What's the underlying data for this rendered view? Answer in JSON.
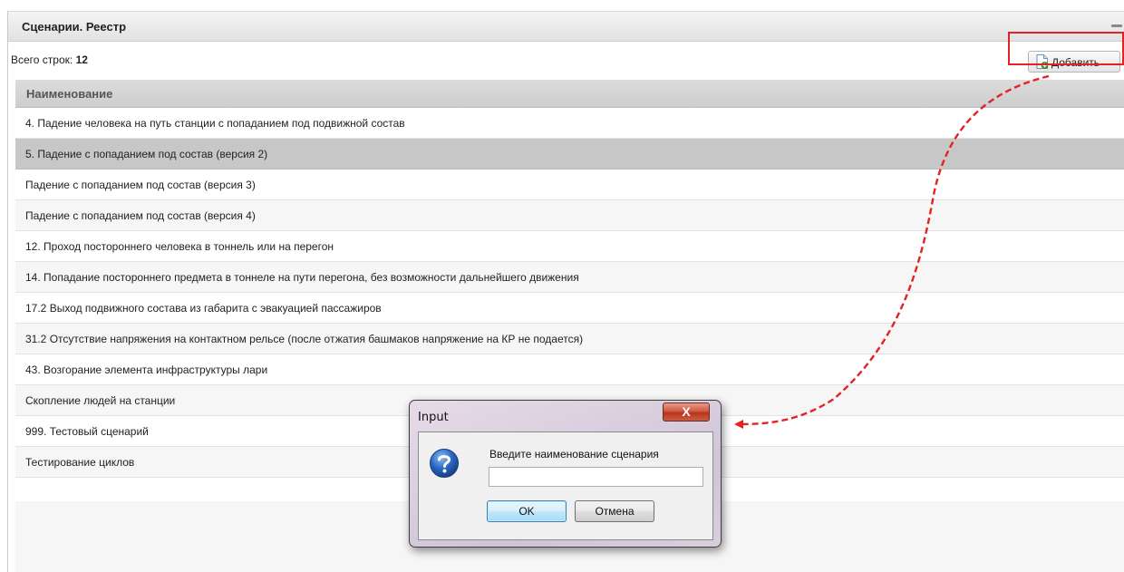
{
  "panel": {
    "title": "Сценарии. Реестр"
  },
  "toolbar": {
    "rows_label": "Всего строк:",
    "rows_count": "12",
    "add_label": "Добавить"
  },
  "grid": {
    "column_header": "Наименование",
    "selected_row_index": 1,
    "rows": [
      "4. Падение человека на путь станции с попаданием под подвижной состав",
      "5. Падение с попаданием под состав (версия 2)",
      "Падение с попаданием под состав (версия 3)",
      "Падение с попаданием под состав (версия 4)",
      "12. Проход постороннего человека в тоннель или на перегон",
      "14. Попадание постороннего предмета в тоннеле на пути перегона, без возможности дальнейшего движения",
      "17.2 Выход подвижного состава из габарита с эвакуацией пассажиров",
      "31.2 Отсутствие напряжения на контактном рельсе (после отжатия башмаков напряжение на КР не подается)",
      "43. Возгорание элемента инфраструктуры лари",
      "Скопление людей на станции",
      "999. Тестовый сценарий",
      "Тестирование циклов"
    ]
  },
  "dialog": {
    "title": "Input",
    "close_label": "X",
    "prompt": "Введите наименование сценария",
    "input_value": "",
    "ok_label": "OK",
    "cancel_label": "Отмена"
  },
  "icons": {
    "add": "document-add-icon",
    "question": "question-icon",
    "collapse": "collapse-icon"
  },
  "colors": {
    "annotation": "#e32222",
    "selected_row": "#c7c7c7"
  }
}
